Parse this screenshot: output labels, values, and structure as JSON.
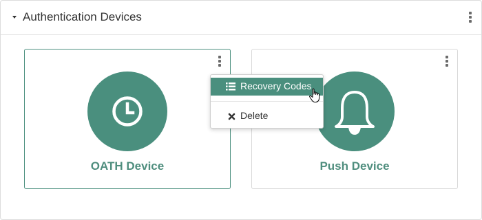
{
  "panel": {
    "title": "Authentication Devices",
    "icons": {
      "collapse": "caret-down-icon",
      "menu": "kebab-menu-icon"
    }
  },
  "devices": [
    {
      "label": "OATH Device",
      "icon": "clock-icon",
      "selected": true
    },
    {
      "label": "Push Device",
      "icon": "bell-icon",
      "selected": false
    }
  ],
  "dropdown": {
    "items": [
      {
        "label": "Recovery Codes",
        "icon": "list-icon",
        "highlighted": true
      },
      {
        "label": "Delete",
        "icon": "close-x-icon",
        "highlighted": false
      }
    ]
  },
  "colors": {
    "accent": "#4a8f7e",
    "label_text": "#4f8e7e",
    "border": "#dcdcdc"
  }
}
